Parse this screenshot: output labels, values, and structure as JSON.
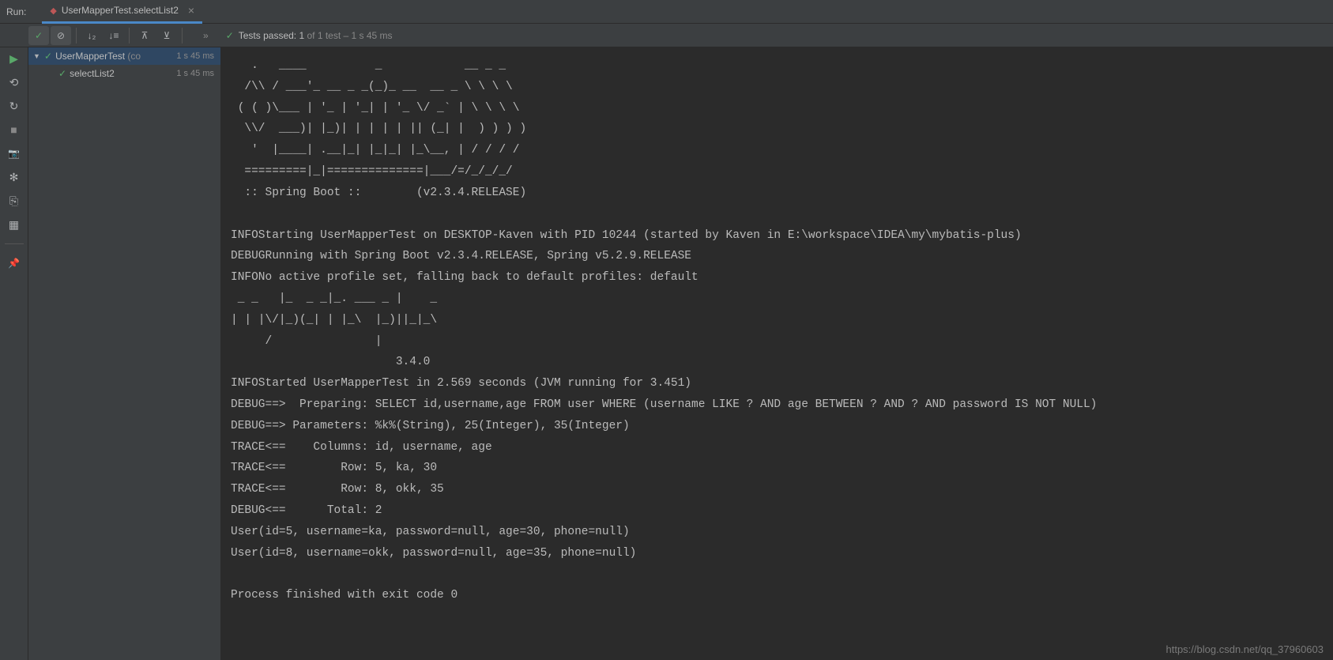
{
  "topBar": {
    "runLabel": "Run:",
    "tab": {
      "icon": "◆",
      "label": "UserMapperTest.selectList2",
      "close": "×"
    }
  },
  "toolbar": {
    "check": "✓",
    "disable": "⊘",
    "sortDown": "↓₂",
    "sortUp": "↓≡",
    "collapse": "⊼",
    "expand": "⊻",
    "more": "»",
    "statusCheck": "✓",
    "testsPassedPrefix": "Tests passed: ",
    "testsPassedCount": "1",
    "testsPassedSuffix": " of 1 test – 1 s 45 ms"
  },
  "gutterIcons": {
    "play": "▶",
    "debug": "⟲",
    "rerun": "↻",
    "stop": "■",
    "camera": "📷",
    "bug": "✻",
    "exit": "⎘",
    "layout": "▦",
    "pin": "📌"
  },
  "tree": {
    "arrow": "▼",
    "check": "✓",
    "root": {
      "label": "UserMapperTest",
      "extra": " (co",
      "time": "1 s 45 ms"
    },
    "child": {
      "label": "selectList2",
      "time": "1 s 45 ms"
    }
  },
  "console": {
    "lines": [
      "   .   ____          _            __ _ _",
      "  /\\\\ / ___'_ __ _ _(_)_ __  __ _ \\ \\ \\ \\",
      " ( ( )\\___ | '_ | '_| | '_ \\/ _` | \\ \\ \\ \\",
      "  \\\\/  ___)| |_)| | | | | || (_| |  ) ) ) )",
      "   '  |____| .__|_| |_|_| |_\\__, | / / / /",
      "  =========|_|==============|___/=/_/_/_/",
      "  :: Spring Boot ::        (v2.3.4.RELEASE)",
      "",
      "INFOStarting UserMapperTest on DESKTOP-Kaven with PID 10244 (started by Kaven in E:\\workspace\\IDEA\\my\\mybatis-plus)",
      "DEBUGRunning with Spring Boot v2.3.4.RELEASE, Spring v5.2.9.RELEASE",
      "INFONo active profile set, falling back to default profiles: default",
      " _ _   |_  _ _|_. ___ _ |    _",
      "| | |\\/|_)(_| | |_\\  |_)||_|_\\",
      "     /               |",
      "                        3.4.0",
      "INFOStarted UserMapperTest in 2.569 seconds (JVM running for 3.451)",
      "DEBUG==>  Preparing: SELECT id,username,age FROM user WHERE (username LIKE ? AND age BETWEEN ? AND ? AND password IS NOT NULL)",
      "DEBUG==> Parameters: %k%(String), 25(Integer), 35(Integer)",
      "TRACE<==    Columns: id, username, age",
      "TRACE<==        Row: 5, ka, 30",
      "TRACE<==        Row: 8, okk, 35",
      "DEBUG<==      Total: 2",
      "User(id=5, username=ka, password=null, age=30, phone=null)",
      "User(id=8, username=okk, password=null, age=35, phone=null)",
      "",
      "Process finished with exit code 0"
    ]
  },
  "watermark": "https://blog.csdn.net/qq_37960603"
}
